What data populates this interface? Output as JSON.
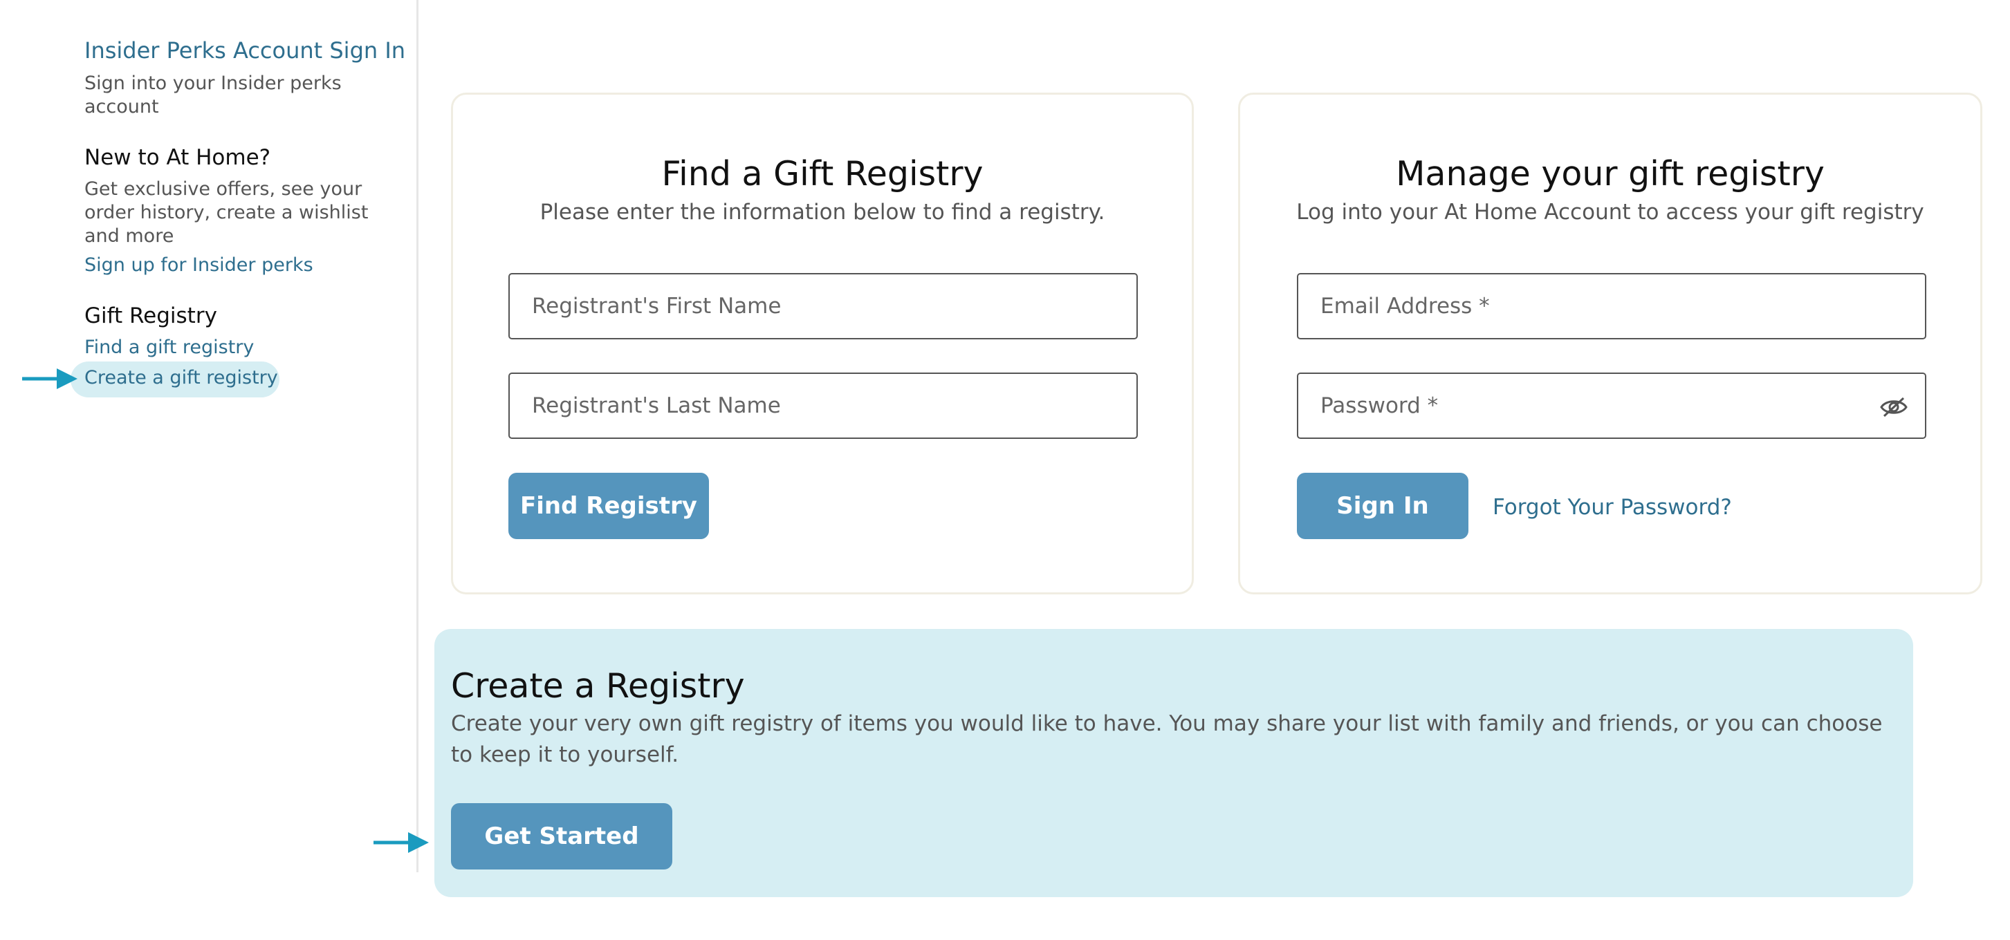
{
  "sidebar": {
    "insider_title": "Insider Perks Account Sign In",
    "insider_desc": "Sign into your Insider perks account",
    "new_heading": "New to At Home?",
    "new_desc": "Get exclusive offers, see your order history, create a wishlist and more",
    "signup_link": "Sign up for Insider perks",
    "registry_heading": "Gift Registry",
    "find_link": "Find a gift registry",
    "create_link": "Create a gift registry"
  },
  "find_card": {
    "title": "Find a Gift Registry",
    "subtitle": "Please enter the information below to find a registry.",
    "first_name_placeholder": "Registrant's First Name",
    "last_name_placeholder": "Registrant's Last Name",
    "button": "Find Registry"
  },
  "manage_card": {
    "title": "Manage your gift registry",
    "subtitle": "Log into your At Home Account to access your gift registry",
    "email_placeholder": "Email Address *",
    "password_placeholder": "Password *",
    "button": "Sign In",
    "forgot": "Forgot Your Password?"
  },
  "create_registry": {
    "title": "Create a Registry",
    "text": "Create your very own gift registry of items you would like to have. You may share your list with family and friends, or you can choose to keep it to yourself.",
    "button": "Get Started"
  },
  "colors": {
    "accent": "#5595bd",
    "link": "#2e6e8e",
    "highlight": "#d6eef3",
    "arrow": "#1a9bbf"
  }
}
